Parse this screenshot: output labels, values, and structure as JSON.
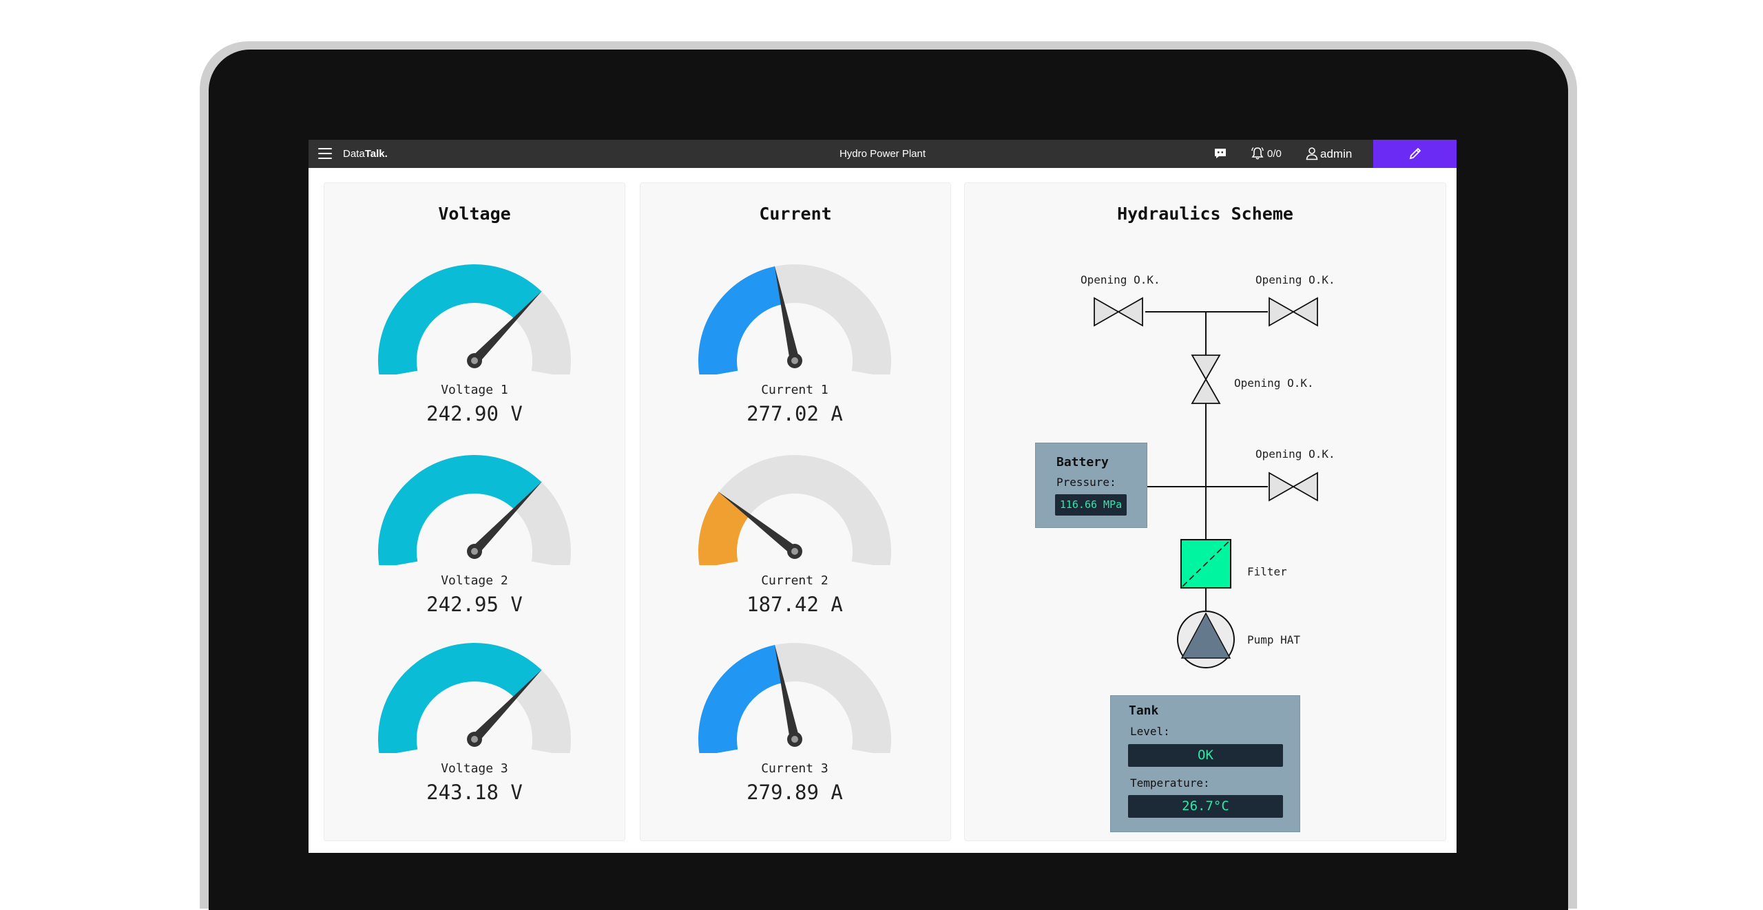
{
  "app": {
    "brand_light": "Data",
    "brand_bold": "Talk.",
    "title": "Hydro Power Plant",
    "alarm_count": "0/0",
    "user": "admin"
  },
  "icons": {
    "menu": "menu-icon",
    "chat": "chat-icon",
    "bell": "bell-icon",
    "user": "user-icon",
    "edit": "pencil-icon"
  },
  "colors": {
    "accent": "#6c2bf5",
    "voltage": "#0bbcd6",
    "current_blue": "#2196f3",
    "current_orange": "#f0a030",
    "gauge_bg": "#e2e2e2",
    "filter": "#00f5a0",
    "lcd_text": "#2ee8a6"
  },
  "voltage": {
    "title": "Voltage",
    "gauges": [
      {
        "label": "Voltage 1",
        "value": "242.90 V",
        "fraction": 0.72
      },
      {
        "label": "Voltage 2",
        "value": "242.95 V",
        "fraction": 0.72
      },
      {
        "label": "Voltage 3",
        "value": "243.18 V",
        "fraction": 0.72
      }
    ]
  },
  "current": {
    "title": "Current",
    "gauges": [
      {
        "label": "Current 1",
        "value": "277.02 A",
        "fraction": 0.44
      },
      {
        "label": "Current 2",
        "value": "187.42 A",
        "fraction": 0.24
      },
      {
        "label": "Current 3",
        "value": "279.89 A",
        "fraction": 0.44
      }
    ]
  },
  "hydraulics": {
    "title": "Hydraulics Scheme",
    "valve_top_left": "Opening O.K.",
    "valve_top_right": "Opening O.K.",
    "valve_middle": "Opening O.K.",
    "valve_right": "Opening O.K.",
    "battery": {
      "title": "Battery",
      "pressure_label": "Pressure:",
      "pressure_value": "116.66 MPa"
    },
    "filter_label": "Filter",
    "pump_label": "Pump HAT",
    "tank": {
      "title": "Tank",
      "level_label": "Level:",
      "level_value": "OK",
      "temperature_label": "Temperature:",
      "temperature_value": "26.7°C"
    }
  }
}
